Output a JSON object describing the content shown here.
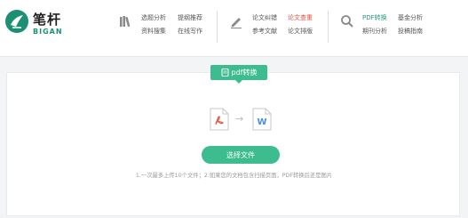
{
  "header": {
    "logo": {
      "title": "笔杆",
      "subtitle": "BIGAN"
    },
    "groups": [
      {
        "icon": "books-icon",
        "links": [
          "选题分析",
          "提纲推荐",
          "资料搜集",
          "在线写作"
        ]
      },
      {
        "icon": "pen-icon",
        "links": [
          "论文纠错",
          "论文查重",
          "参考文献",
          "论文排版"
        ]
      },
      {
        "icon": "search-icon",
        "links": [
          "PDF转换",
          "基金分析",
          "期刊分析",
          "投稿指南"
        ]
      }
    ]
  },
  "main": {
    "badge_label": "pdf转换",
    "source_icon": "pdf-file-icon",
    "target_icon": "word-file-icon",
    "target_letter": "W",
    "arrow": "→",
    "select_button": "选择文件",
    "hint": "1.一次最多上传10个文件；2.如果您的文档包含扫描页面，PDF转换后还是图片"
  },
  "colors": {
    "accent": "#3dbd8f",
    "brand": "#1f8f74",
    "active_red": "#e74c3c",
    "active_green": "#1f9b7a"
  }
}
